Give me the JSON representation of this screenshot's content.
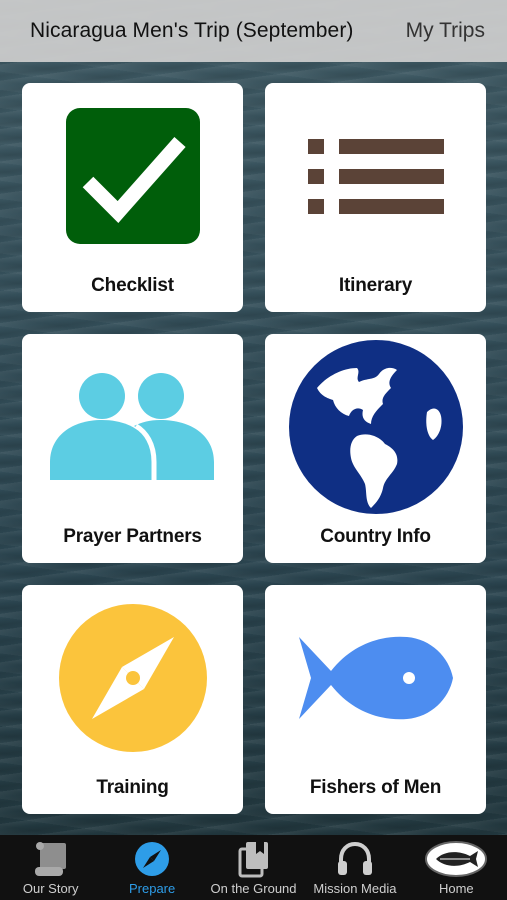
{
  "header": {
    "title": "Nicaragua Men's Trip (September)",
    "my_trips": "My Trips"
  },
  "tiles": [
    {
      "label": "Checklist",
      "icon": "checkmark-box-icon"
    },
    {
      "label": "Itinerary",
      "icon": "list-icon"
    },
    {
      "label": "Prayer Partners",
      "icon": "people-icon"
    },
    {
      "label": "Country Info",
      "icon": "globe-icon"
    },
    {
      "label": "Training",
      "icon": "compass-icon"
    },
    {
      "label": "Fishers of Men",
      "icon": "fish-icon"
    }
  ],
  "tabbar": {
    "items": [
      {
        "label": "Our Story",
        "icon": "scroll-icon"
      },
      {
        "label": "Prepare",
        "icon": "compass-icon",
        "active": true
      },
      {
        "label": "On the Ground",
        "icon": "bookmark-book-icon"
      },
      {
        "label": "Mission Media",
        "icon": "headphones-icon"
      },
      {
        "label": "Home",
        "icon": "fish-logo-icon"
      }
    ]
  },
  "colors": {
    "checklist_green": "#005e0a",
    "itinerary_brown": "#5b4337",
    "people_cyan": "#5ccde3",
    "globe_blue": "#0f2f84",
    "compass_yellow": "#fbc43c",
    "fish_blue": "#4d8df0",
    "active_tab": "#2e9de8"
  }
}
